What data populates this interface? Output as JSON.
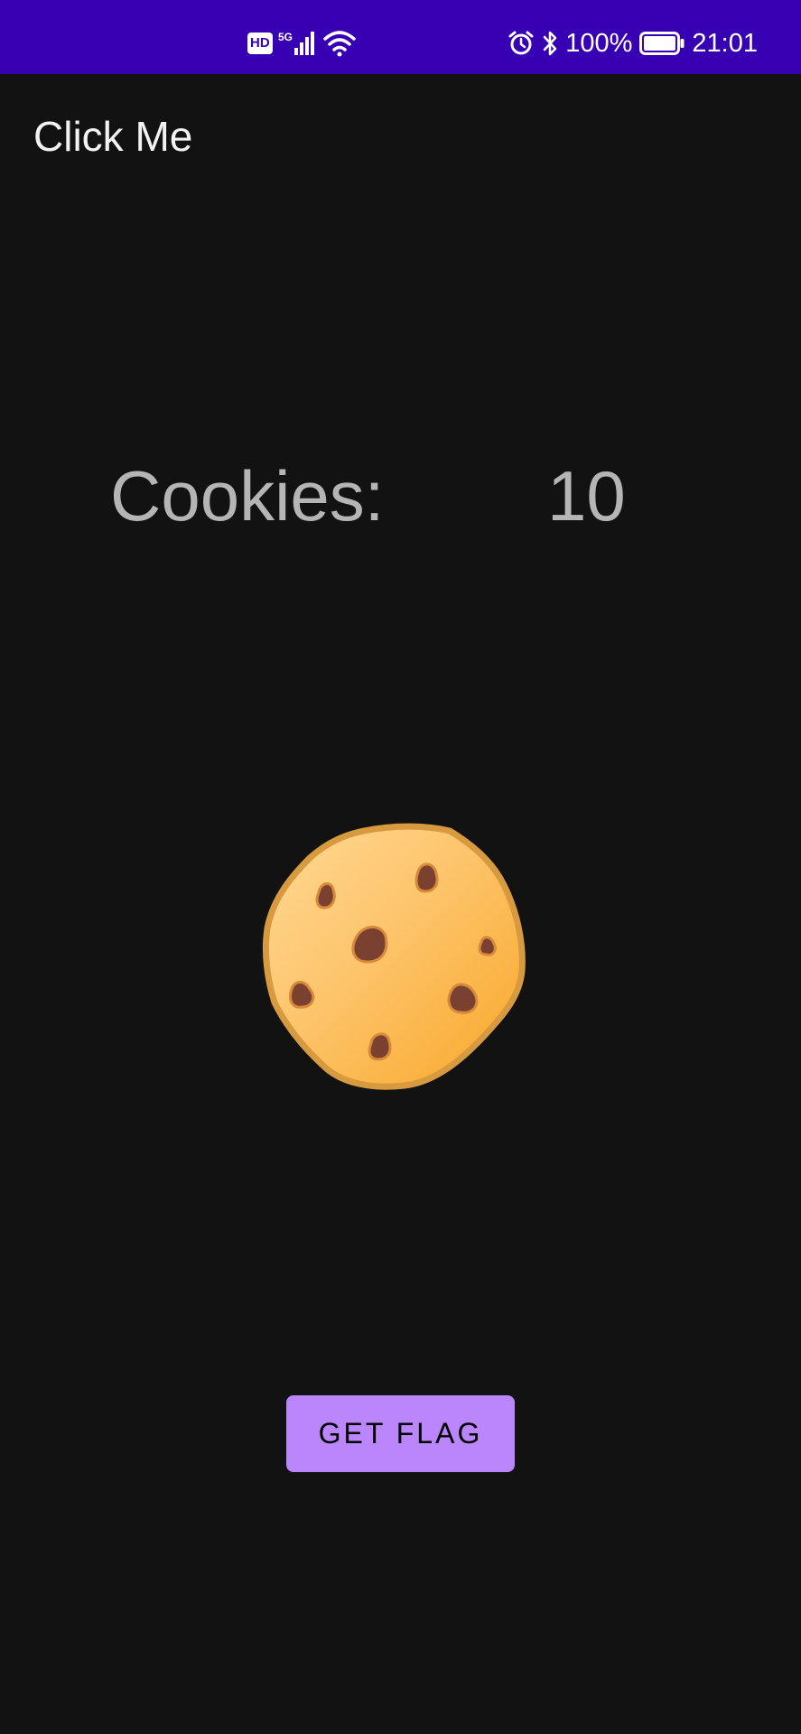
{
  "status_bar": {
    "network_badge": "HD",
    "network_type": "5G",
    "battery_percent": "100%",
    "time": "21:01",
    "background_color": "#3700b3",
    "icons": [
      "hd-icon",
      "signal-icon",
      "wifi-icon",
      "alarm-icon",
      "bluetooth-icon",
      "battery-icon"
    ]
  },
  "app_bar": {
    "title": "Click Me"
  },
  "counter": {
    "label": "Cookies:",
    "value": "10"
  },
  "cookie": {
    "icon": "cookie-icon"
  },
  "actions": {
    "get_flag_label": "GET FLAG",
    "button_color": "#bb86fc"
  },
  "theme": {
    "background": "#121212",
    "text_secondary": "#b5b5b5"
  }
}
